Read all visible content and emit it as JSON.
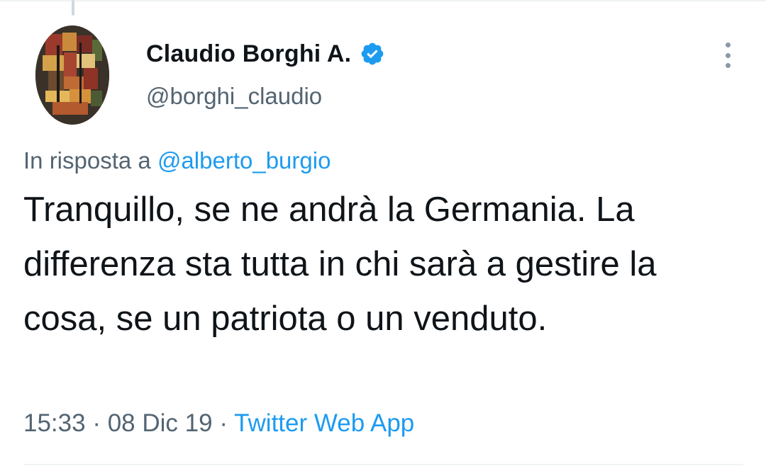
{
  "author": {
    "display_name": "Claudio Borghi A.",
    "handle": "@borghi_claudio",
    "verified_icon": "verified-badge-icon"
  },
  "reply": {
    "prefix": "In risposta a",
    "mention": "@alberto_burgio"
  },
  "tweet": {
    "text": "Tranquillo, se ne andrà la Germania. La differenza sta tutta in chi sarà a gestire la cosa, se un patriota o un venduto."
  },
  "meta": {
    "time": "15:33",
    "separator": "·",
    "date": "08 Dic 19",
    "source": "Twitter Web App"
  },
  "colors": {
    "text": "#0f1419",
    "secondary": "#536471",
    "link": "#1d9bf0",
    "verified": "#1d9bf0"
  }
}
